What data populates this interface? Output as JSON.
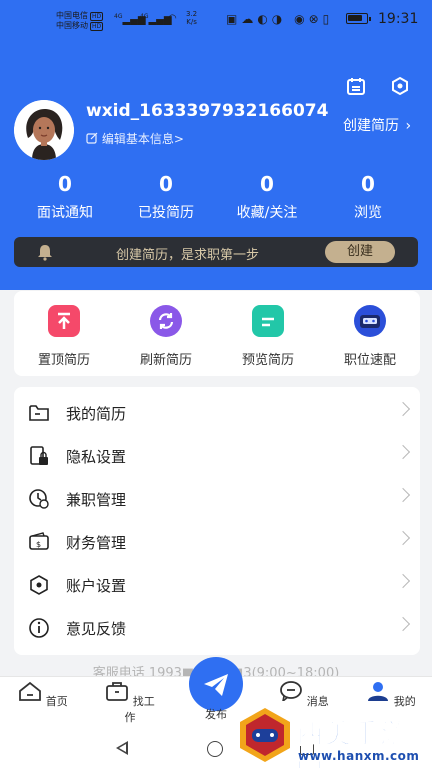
{
  "status_bar": {
    "carrier1": "中国电信",
    "carrier2": "中国移动",
    "hd_tag": "HD",
    "net1": "4G",
    "net2": "4G",
    "speed_value": "3.2",
    "speed_unit": "K/s",
    "time": "19:31",
    "battery_level": 0.85
  },
  "header": {
    "calendar_icon": "calendar-icon",
    "settings_icon": "hexagon-settings-icon"
  },
  "profile": {
    "username": "wxid_1633397932166074",
    "edit_label": "编辑基本信息>",
    "create_resume_label": "创建简历"
  },
  "stats": [
    {
      "count": "0",
      "label": "面试通知"
    },
    {
      "count": "0",
      "label": "已投简历"
    },
    {
      "count": "0",
      "label": "收藏/关注"
    },
    {
      "count": "0",
      "label": "浏览"
    }
  ],
  "banner": {
    "text": "创建简历，是求职第一步",
    "button": "创建"
  },
  "quick_actions": [
    {
      "label": "置顶简历",
      "icon": "pin-top-icon",
      "color": "#f5496a"
    },
    {
      "label": "刷新简历",
      "icon": "refresh-icon",
      "color": "#8a58e8"
    },
    {
      "label": "预览简历",
      "icon": "document-preview-icon",
      "color": "#22c7a8"
    },
    {
      "label": "职位速配",
      "icon": "job-match-icon",
      "color": "#2b4fd9"
    }
  ],
  "menu": [
    {
      "label": "我的简历",
      "icon": "folder-icon"
    },
    {
      "label": "隐私设置",
      "icon": "privacy-lock-icon"
    },
    {
      "label": "兼职管理",
      "icon": "clock-settings-icon"
    },
    {
      "label": "财务管理",
      "icon": "wallet-icon"
    },
    {
      "label": "账户设置",
      "icon": "hexagon-settings-icon"
    },
    {
      "label": "意见反馈",
      "icon": "info-icon"
    }
  ],
  "service_line": "客服电话 1993■■■■■3(9:00~18:00)",
  "tabs": [
    {
      "label": "首页",
      "icon": "home-icon"
    },
    {
      "label": "找工作",
      "icon": "briefcase-icon"
    },
    {
      "label": "发布",
      "icon": "send-icon"
    },
    {
      "label": "消息",
      "icon": "message-icon"
    },
    {
      "label": "我的",
      "icon": "user-icon",
      "active": true
    }
  ],
  "watermark": {
    "title": "西美手游网",
    "url": "www.hanxm.com"
  },
  "colors": {
    "primary": "#2f6ff2",
    "banner_bg": "#2c2f35",
    "banner_button": "#c4b08f"
  }
}
